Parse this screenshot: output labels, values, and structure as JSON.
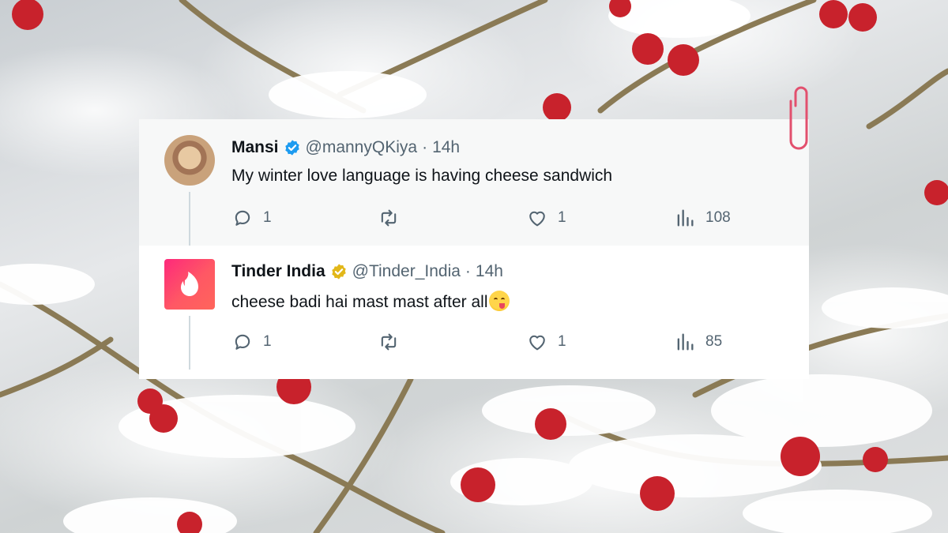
{
  "tweets": [
    {
      "name": "Mansi",
      "verified_color": "#1d9bf0",
      "handle": "@mannyQKiya",
      "time": "14h",
      "text": "My winter love language is having cheese sandwich",
      "replies": "1",
      "retweets": "",
      "likes": "1",
      "views": "108"
    },
    {
      "name": "Tinder India",
      "verified_color": "#e2b719",
      "handle": "@Tinder_India",
      "time": "14h",
      "text": "cheese badi hai mast mast after all",
      "emoji": "yum-face-emoji",
      "replies": "1",
      "retweets": "",
      "likes": "1",
      "views": "85"
    }
  ],
  "separator": "·",
  "colors": {
    "brand_tinder": "#fd297b",
    "text": "#0f1419",
    "muted": "#536471",
    "clip": "#e2506e"
  },
  "icons": [
    "reply-icon",
    "retweet-icon",
    "like-icon",
    "views-icon",
    "verified-badge-icon",
    "paperclip-icon",
    "tinder-flame-icon"
  ]
}
